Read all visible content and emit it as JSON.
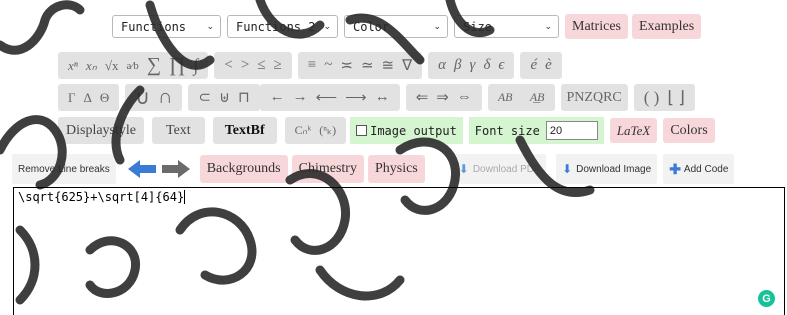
{
  "selects": [
    {
      "label": "Functions"
    },
    {
      "label": "Functions 2"
    },
    {
      "label": "Color"
    },
    {
      "label": "Size"
    }
  ],
  "top_buttons": {
    "matrices": "Matrices",
    "examples": "Examples"
  },
  "row1": {
    "powers": [
      "xⁿ",
      "xₙ",
      "√x",
      "a⁄b",
      "∑",
      "∏",
      "∫"
    ],
    "relations": [
      "<",
      ">",
      "≤",
      "≥"
    ],
    "equivalence": [
      "≡",
      "~",
      "≍",
      "≃",
      "≅",
      "∇"
    ],
    "greek": [
      "α",
      "β",
      "γ",
      "δ",
      "ϵ"
    ],
    "accents": [
      "é",
      "è"
    ]
  },
  "row2": {
    "greek_upper": [
      "Γ",
      "Δ",
      "Θ"
    ],
    "sets1": [
      "∪",
      "∩"
    ],
    "sets2": [
      "⊂",
      "⊎",
      "⊓"
    ],
    "arrows": [
      "←",
      "→",
      "⟵",
      "⟶",
      "↔"
    ],
    "double_arrows": [
      "⇐",
      "⇒",
      "⇔"
    ],
    "vectors": [
      "AB⃗",
      "A͟B"
    ],
    "fonts": "PNZQRC",
    "brackets": [
      "( )",
      "⌊ ⌋"
    ]
  },
  "row3": {
    "displaystyle": "Displaystyle",
    "text": "Text",
    "textbf": "TextBf",
    "binom": [
      "Cₙᵏ",
      "(ⁿₖ)"
    ],
    "image_output": "Image output",
    "font_size_label": "Font size",
    "font_size_value": "20",
    "latex": "LaTeX",
    "colors": "Colors"
  },
  "row4": {
    "remove_line_breaks": "Remove Line breaks",
    "backgrounds": "Backgrounds",
    "chemistry": "Chimestry",
    "physics": "Physics",
    "download_pdf": "Download PDF",
    "download_image": "Download Image",
    "add_code": "Add Code"
  },
  "editor": {
    "content": "\\sqrt{625}+\\sqrt[4]{64}"
  },
  "colors": {
    "blue": "#3a7bd5",
    "gray_arrow": "#6b6b6b",
    "pink": "#f8d7da",
    "green": "#d4f5cf"
  }
}
